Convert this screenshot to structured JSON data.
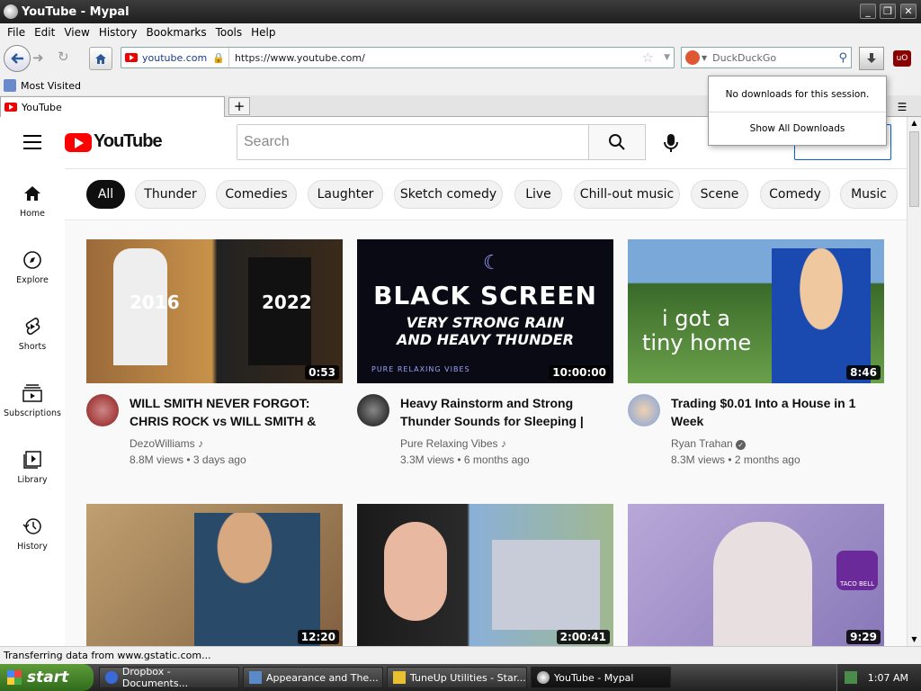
{
  "window": {
    "title": "YouTube - Mypal"
  },
  "menu": [
    "File",
    "Edit",
    "View",
    "History",
    "Bookmarks",
    "Tools",
    "Help"
  ],
  "urlbar": {
    "site": "youtube.com",
    "url": "https://www.youtube.com/"
  },
  "search": {
    "placeholder": "DuckDuckGo"
  },
  "bookmarks": {
    "most_visited": "Most Visited"
  },
  "tab": {
    "label": "YouTube"
  },
  "downloads": {
    "message": "No downloads for this session.",
    "show_all": "Show All Downloads"
  },
  "youtube": {
    "logo_text": "YouTube",
    "search_placeholder": "Search",
    "sidebar": [
      {
        "label": "Home",
        "icon": "home-icon"
      },
      {
        "label": "Explore",
        "icon": "compass-icon"
      },
      {
        "label": "Shorts",
        "icon": "shorts-icon"
      },
      {
        "label": "Subscriptions",
        "icon": "subscriptions-icon"
      },
      {
        "label": "Library",
        "icon": "library-icon"
      },
      {
        "label": "History",
        "icon": "history-icon"
      }
    ],
    "chips": [
      "All",
      "Thunder",
      "Comedies",
      "Laughter",
      "Sketch comedy",
      "Live",
      "Chill-out music",
      "Scene",
      "Comedy",
      "Music"
    ],
    "videos": [
      {
        "title_line1": "WILL SMITH NEVER FORGOT:",
        "title_line2": "CHRIS ROCK vs WILL SMITH &",
        "channel": "DezoWilliams",
        "views": "8.8M views",
        "age": "3 days ago",
        "duration": "0:53",
        "thumb_text1": "2016",
        "thumb_text2": "2022"
      },
      {
        "title_line1": "Heavy Rainstorm and Strong",
        "title_line2": "Thunder Sounds for Sleeping |",
        "channel": "Pure Relaxing Vibes",
        "views": "3.3M views",
        "age": "6 months ago",
        "duration": "10:00:00",
        "thumb_text1": "BLACK SCREEN",
        "thumb_text2": "VERY STRONG RAIN",
        "thumb_text3": "AND HEAVY THUNDER",
        "thumb_text4": "PURE RELAXING VIBES"
      },
      {
        "title_line1": "Trading $0.01 Into a House in 1",
        "title_line2": "Week",
        "channel": "Ryan Trahan",
        "views": "8.3M views",
        "age": "2 months ago",
        "duration": "8:46",
        "thumb_text1": "i got a",
        "thumb_text2": "tiny home"
      },
      {
        "duration": "12:20"
      },
      {
        "duration": "2:00:41"
      },
      {
        "duration": "9:29",
        "thumb_text1": "TACO BELL"
      }
    ]
  },
  "status": {
    "text": "Transferring data from www.gstatic.com..."
  },
  "taskbar": {
    "start": "start",
    "tasks": [
      "Dropbox - Documents...",
      "Appearance and The...",
      "TuneUp Utilities - Star...",
      "YouTube - Mypal"
    ],
    "clock": "1:07 AM"
  }
}
